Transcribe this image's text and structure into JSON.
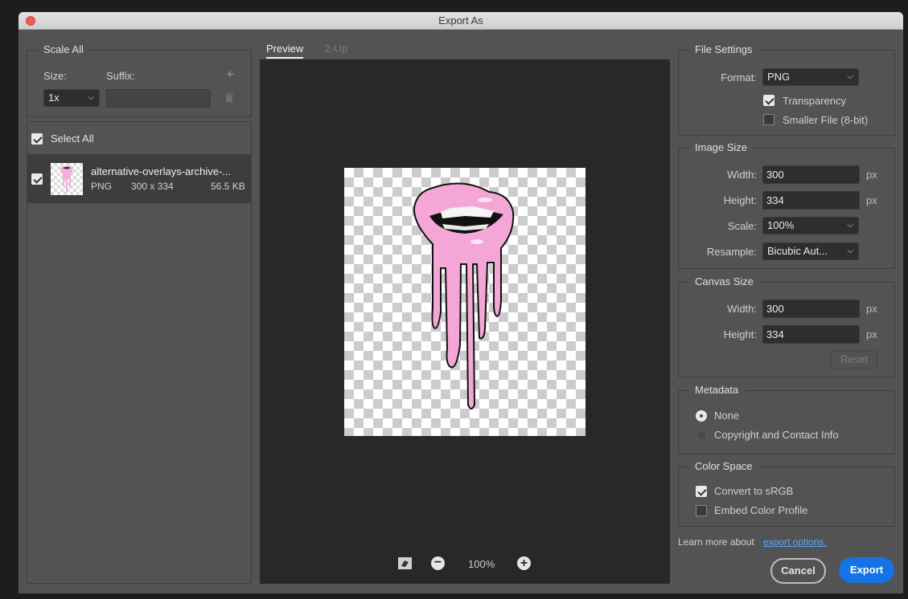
{
  "window": {
    "title": "Export As"
  },
  "scale_all": {
    "legend": "Scale All",
    "size_label": "Size:",
    "suffix_label": "Suffix:",
    "size_value": "1x",
    "suffix_value": "",
    "add_icon": "plus-icon",
    "delete_icon": "trash-icon"
  },
  "assets": {
    "select_all_label": "Select All",
    "select_all_checked": true,
    "items": [
      {
        "name": "alternative-overlays-archive-...",
        "format": "PNG",
        "dimensions": "300 x 334",
        "filesize": "56.5 KB",
        "checked": true
      }
    ]
  },
  "preview": {
    "tabs": [
      "Preview",
      "2-Up"
    ],
    "active_tab": "Preview",
    "zoom": "100%",
    "icons": [
      "fit-screen-icon",
      "zoom-out-icon",
      "zoom-in-icon"
    ]
  },
  "file_settings": {
    "legend": "File Settings",
    "format_label": "Format:",
    "format_value": "PNG",
    "transparency_label": "Transparency",
    "transparency_checked": true,
    "smaller_file_label": "Smaller File (8-bit)",
    "smaller_file_checked": false
  },
  "image_size": {
    "legend": "Image Size",
    "width_label": "Width:",
    "width_value": "300",
    "height_label": "Height:",
    "height_value": "334",
    "scale_label": "Scale:",
    "scale_value": "100%",
    "resample_label": "Resample:",
    "resample_value": "Bicubic Aut...",
    "unit": "px"
  },
  "canvas_size": {
    "legend": "Canvas Size",
    "width_label": "Width:",
    "width_value": "300",
    "height_label": "Height:",
    "height_value": "334",
    "unit": "px",
    "reset_label": "Reset"
  },
  "metadata": {
    "legend": "Metadata",
    "options": [
      "None",
      "Copyright and Contact Info"
    ],
    "selected": "None"
  },
  "color_space": {
    "legend": "Color Space",
    "convert_label": "Convert to sRGB",
    "convert_checked": true,
    "embed_label": "Embed Color Profile",
    "embed_checked": false
  },
  "footer": {
    "learn_more": "Learn more about",
    "link": "export options.",
    "cancel_label": "Cancel",
    "export_label": "Export"
  },
  "colors": {
    "accent": "#1473e6",
    "link": "#5aa6f0",
    "panel": "#535353",
    "preview_bg": "#282828"
  }
}
